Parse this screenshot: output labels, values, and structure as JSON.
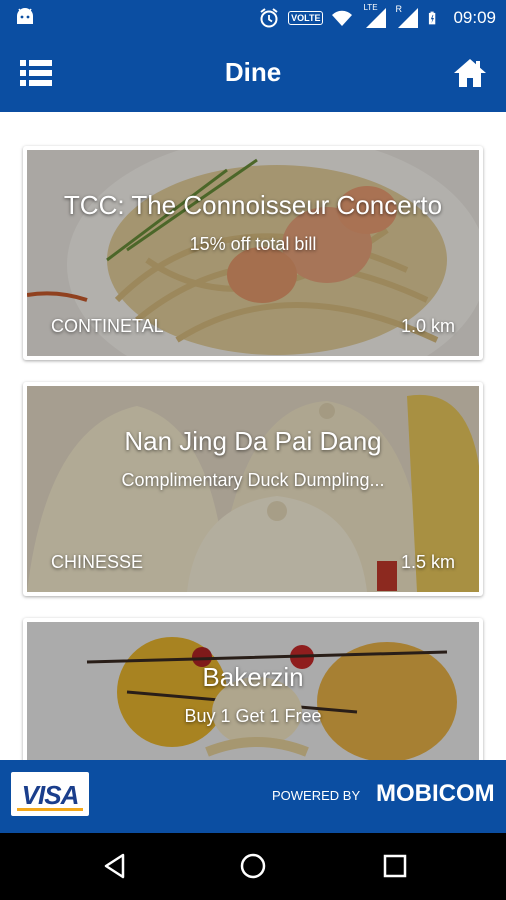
{
  "status_bar": {
    "volte_label": "VOLTE",
    "time": "09:09",
    "network_label_1": "LTE",
    "network_label_2": "R"
  },
  "app_bar": {
    "title": "Dine",
    "menu_icon": "list-icon",
    "home_icon": "home-icon"
  },
  "restaurants": [
    {
      "name": "TCC: The Connoisseur Concerto",
      "offer": "15% off total bill",
      "cuisine": "CONTINETAL",
      "distance": "1.0 km",
      "image": "pasta-shrimp-photo"
    },
    {
      "name": "Nan Jing Da Pai Dang",
      "offer": "Complimentary Duck Dumpling...",
      "cuisine": "CHINESSE",
      "distance": "1.5 km",
      "image": "dumplings-photo"
    },
    {
      "name": "Bakerzin",
      "offer": "Buy 1 Get 1 Free",
      "cuisine": "",
      "distance": "",
      "image": "dessert-photo"
    }
  ],
  "footer": {
    "visa_logo": "VISA",
    "powered_by": "POWERED BY",
    "mobicom_logo": "MOBICOM"
  },
  "colors": {
    "primary": "#0b4ea2",
    "navbar": "#000000"
  }
}
